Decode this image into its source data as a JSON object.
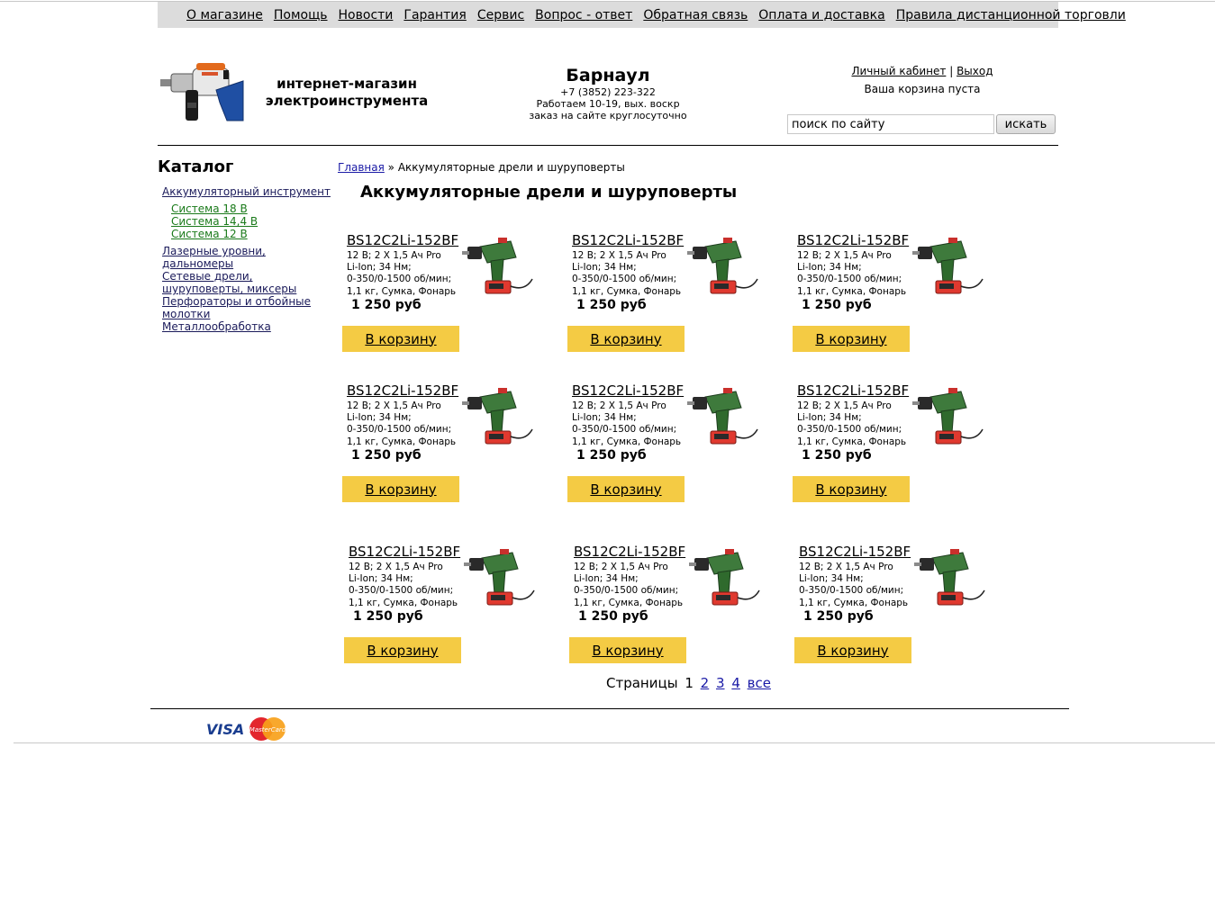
{
  "nav": {
    "links": [
      "О магазине",
      "Помощь",
      "Новости",
      "Гарантия",
      "Сервис",
      "Вопрос - ответ",
      "Обратная связь",
      "Оплата и доставка",
      "Правила дистанционной торговли"
    ]
  },
  "header": {
    "tagline_line1": "интернет-магазин",
    "tagline_line2": "электроинструмента",
    "city": "Барнаул",
    "phone": "+7 (3852) 223-322",
    "hours": "Работаем 10-19, вых. воскр",
    "online": "заказ на сайте круглосуточно",
    "account_link": "Личный кабинет",
    "separator": "|",
    "logout_link": "Выход",
    "cart_status": "Ваша корзина пуста",
    "search_placeholder": "поиск по сайту",
    "search_button": "искать"
  },
  "sidebar": {
    "title": "Каталог",
    "items": [
      {
        "label": "Аккумуляторный инструмент",
        "sub": [
          "Система 18 В",
          "Система 14,4 В",
          "Система 12 В"
        ]
      },
      {
        "label": "Лазерные уровни, дальномеры",
        "sub": []
      },
      {
        "label": "Сетевые дрели, шуруповерты, миксеры",
        "sub": []
      },
      {
        "label": "Перфораторы и отбойные молотки",
        "sub": []
      },
      {
        "label": "Металлообработка",
        "sub": []
      }
    ]
  },
  "breadcrumb": {
    "home": "Главная",
    "sep": "»",
    "current": "Аккумуляторные дрели и шуруповерты"
  },
  "page_title": "Аккумуляторные дрели и шуруповерты",
  "products": [
    {
      "title": "BS12C2Li-152BF",
      "specs": [
        "12 В; 2 X 1,5 Ач Pro",
        "Li-Ion; 34 Нм;",
        "0-350/0-1500 об/мин;",
        "1,1 кг, Сумка, Фонарь"
      ],
      "price": "1 250 руб",
      "button": "В корзину"
    },
    {
      "title": "BS12C2Li-152BF",
      "specs": [
        "12 В; 2 X 1,5 Ач Pro",
        "Li-Ion; 34 Нм;",
        "0-350/0-1500 об/мин;",
        "1,1 кг, Сумка, Фонарь"
      ],
      "price": "1 250 руб",
      "button": "В корзину"
    },
    {
      "title": "BS12C2Li-152BF",
      "specs": [
        "12 В; 2 X 1,5 Ач Pro",
        "Li-Ion; 34 Нм;",
        "0-350/0-1500 об/мин;",
        "1,1 кг, Сумка, Фонарь"
      ],
      "price": "1 250 руб",
      "button": "В корзину"
    },
    {
      "title": "BS12C2Li-152BF",
      "specs": [
        "12 В; 2 X 1,5 Ач Pro",
        "Li-Ion; 34 Нм;",
        "0-350/0-1500 об/мин;",
        "1,1 кг, Сумка, Фонарь"
      ],
      "price": "1 250 руб",
      "button": "В корзину"
    },
    {
      "title": "BS12C2Li-152BF",
      "specs": [
        "12 В; 2 X 1,5 Ач Pro",
        "Li-Ion; 34 Нм;",
        "0-350/0-1500 об/мин;",
        "1,1 кг, Сумка, Фонарь"
      ],
      "price": "1 250 руб",
      "button": "В корзину"
    },
    {
      "title": "BS12C2Li-152BF",
      "specs": [
        "12 В; 2 X 1,5 Ач Pro",
        "Li-Ion; 34 Нм;",
        "0-350/0-1500 об/мин;",
        "1,1 кг, Сумка, Фонарь"
      ],
      "price": "1 250 руб",
      "button": "В корзину"
    },
    {
      "title": "BS12C2Li-152BF",
      "specs": [
        "12 В; 2 X 1,5 Ач Pro",
        "Li-Ion; 34 Нм;",
        "0-350/0-1500 об/мин;",
        "1,1 кг, Сумка, Фонарь"
      ],
      "price": "1 250 руб",
      "button": "В корзину"
    },
    {
      "title": "BS12C2Li-152BF",
      "specs": [
        "12 В; 2 X 1,5 Ач Pro",
        "Li-Ion; 34 Нм;",
        "0-350/0-1500 об/мин;",
        "1,1 кг, Сумка, Фонарь"
      ],
      "price": "1 250 руб",
      "button": "В корзину"
    },
    {
      "title": "BS12C2Li-152BF",
      "specs": [
        "12 В; 2 X 1,5 Ач Pro",
        "Li-Ion; 34 Нм;",
        "0-350/0-1500 об/мин;",
        "1,1 кг, Сумка, Фонарь"
      ],
      "price": "1 250 руб",
      "button": "В корзину"
    }
  ],
  "pager": {
    "label": "Страницы",
    "current": "1",
    "pages": [
      "2",
      "3",
      "4"
    ],
    "all": "все"
  },
  "footer": {
    "visa": "VISA",
    "mastercard": "MasterCard"
  },
  "colors": {
    "nav_bg": "#dcdcdc",
    "buy_button": "#f4cb44",
    "link_blue": "#1a1aa6",
    "sub_green": "#1a7a1a"
  }
}
